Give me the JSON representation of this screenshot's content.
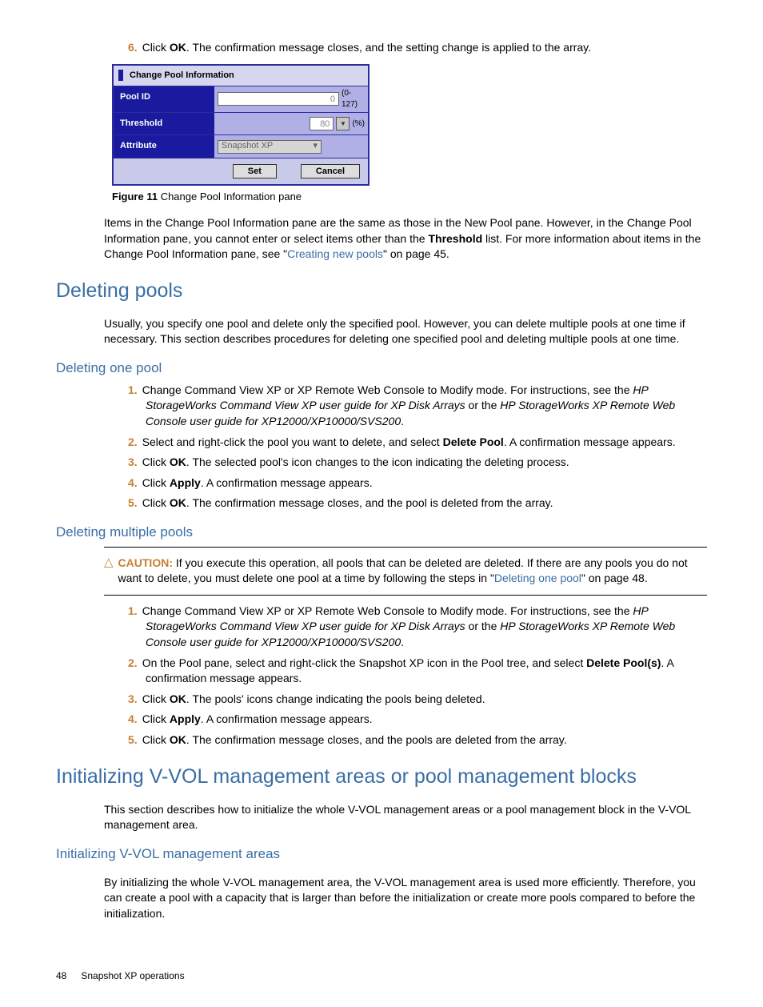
{
  "prelist": {
    "num": "6.",
    "text_a": "Click ",
    "bold": "OK",
    "text_b": ". The confirmation message closes, and the setting change is applied to the array."
  },
  "dialog": {
    "title": "Change Pool Information",
    "rows": {
      "pool_id": {
        "label": "Pool ID",
        "value": "0",
        "range": "(0-127)"
      },
      "threshold": {
        "label": "Threshold",
        "value": "80",
        "unit": "(%)"
      },
      "attribute": {
        "label": "Attribute",
        "value": "Snapshot XP"
      }
    },
    "buttons": {
      "set": "Set",
      "cancel": "Cancel"
    }
  },
  "figure": {
    "label": "Figure 11",
    "caption": " Change Pool Information pane"
  },
  "para_intro": {
    "a": "Items in the Change Pool Information pane are the same as those in the New Pool pane. However, in the Change Pool Information pane, you cannot enter or select items other than the ",
    "bold": "Threshold",
    "b": " list. For more information about items in the Change Pool Information pane, see \"",
    "link": "Creating new pools",
    "c": "\" on page 45."
  },
  "sec1": {
    "title": "Deleting pools",
    "desc": "Usually, you specify one pool and delete only the specified pool. However, you can delete multiple pools at one time if necessary. This section describes procedures for deleting one specified pool and deleting multiple pools at one time."
  },
  "sub1": {
    "title": "Deleting one pool",
    "items": {
      "1": {
        "n": "1.",
        "a": "Change Command View XP or XP Remote Web Console to Modify mode. For instructions, see the ",
        "i1": "HP StorageWorks Command View XP user guide for XP Disk Arrays",
        "mid": " or the ",
        "i2": "HP StorageWorks XP Remote Web Console user guide for XP12000/XP10000/SVS200",
        "end": "."
      },
      "2": {
        "n": "2.",
        "a": "Select and right-click the pool you want to delete, and select ",
        "b": "Delete Pool",
        "c": ". A confirmation message appears."
      },
      "3": {
        "n": "3.",
        "a": "Click ",
        "b": "OK",
        "c": ". The selected pool's icon changes to the icon indicating the deleting process."
      },
      "4": {
        "n": "4.",
        "a": "Click ",
        "b": "Apply",
        "c": ". A confirmation message appears."
      },
      "5": {
        "n": "5.",
        "a": "Click ",
        "b": "OK",
        "c": ". The confirmation message closes, and the pool is deleted from the array."
      }
    }
  },
  "sub2": {
    "title": "Deleting multiple pools",
    "caution": {
      "head": "CAUTION:",
      "a": "   If you execute this operation, all pools that can be deleted are deleted. If there are any pools you do not want to delete, you must delete one pool at a time by following the steps in \"",
      "link": "Deleting one pool",
      "b": "\" on page 48."
    },
    "items": {
      "1": {
        "n": "1.",
        "a": "Change Command View XP or XP Remote Web Console to Modify mode. For instructions, see the ",
        "i1": "HP StorageWorks Command View XP user guide for XP Disk Arrays",
        "mid": " or the ",
        "i2": "HP StorageWorks XP Remote Web Console user guide for XP12000/XP10000/SVS200",
        "end": "."
      },
      "2": {
        "n": "2.",
        "a": "On the Pool pane, select and right-click the Snapshot XP icon in the Pool tree, and select ",
        "b": "Delete Pool(s)",
        "c": ". A confirmation message appears."
      },
      "3": {
        "n": "3.",
        "a": "Click ",
        "b": "OK",
        "c": ". The pools' icons change indicating the pools being deleted."
      },
      "4": {
        "n": "4.",
        "a": "Click ",
        "b": "Apply",
        "c": ". A confirmation message appears."
      },
      "5": {
        "n": "5.",
        "a": "Click ",
        "b": "OK",
        "c": ". The confirmation message closes, and the pools are deleted from the array."
      }
    }
  },
  "sec2": {
    "title": "Initializing V-VOL management areas or pool management blocks",
    "desc": "This section describes how to initialize the whole V-VOL management areas or a pool management block in the V-VOL management area."
  },
  "sub3": {
    "title": "Initializing V-VOL management areas",
    "desc": "By initializing the whole V-VOL management area, the V-VOL management area is used more efficiently. Therefore, you can create a pool with a capacity that is larger than before the initialization or create more pools compared to before the initialization."
  },
  "footer": {
    "page": "48",
    "title": "Snapshot XP operations"
  }
}
